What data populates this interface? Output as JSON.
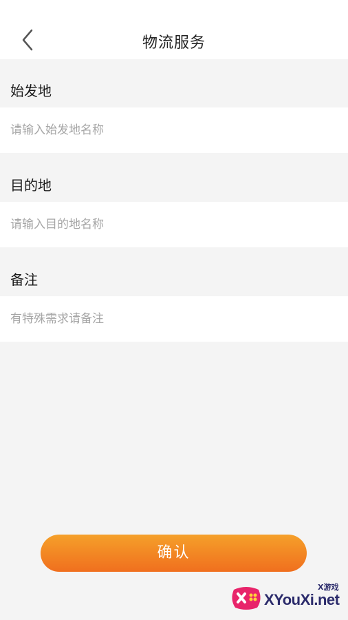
{
  "header": {
    "title": "物流服务"
  },
  "form": {
    "origin": {
      "label": "始发地",
      "placeholder": "请输入始发地名称",
      "value": ""
    },
    "destination": {
      "label": "目的地",
      "placeholder": "请输入目的地名称",
      "value": ""
    },
    "remark": {
      "label": "备注",
      "placeholder": "有特殊需求请备注",
      "value": ""
    }
  },
  "confirm_label": "确认",
  "watermark": {
    "small": "X游戏",
    "main": "XYouXi.net"
  },
  "colors": {
    "accent_top": "#f5a02a",
    "accent_bottom": "#f06f1e",
    "background": "#f4f4f4"
  },
  "icons": {
    "back": "back-chevron-icon"
  }
}
